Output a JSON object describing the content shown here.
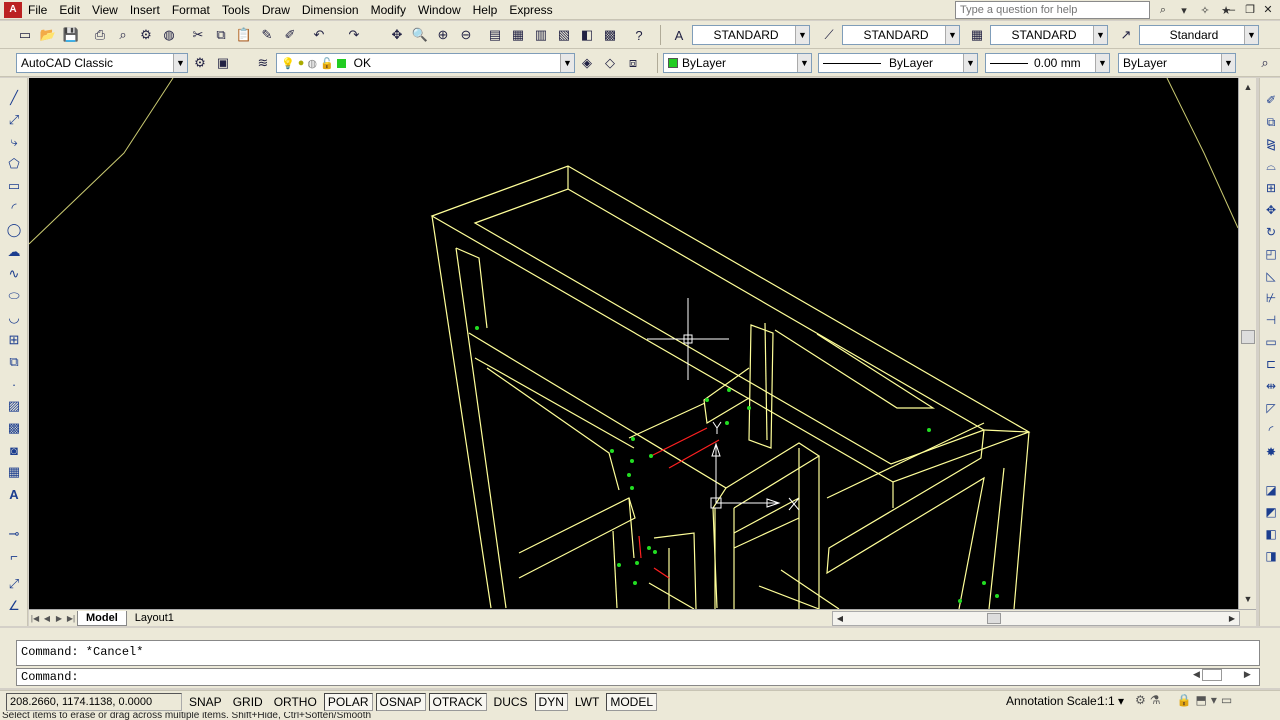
{
  "menubar": {
    "items": [
      "File",
      "Edit",
      "View",
      "Insert",
      "Format",
      "Tools",
      "Draw",
      "Dimension",
      "Modify",
      "Window",
      "Help",
      "Express"
    ],
    "help_placeholder": "Type a question for help"
  },
  "toolbar1": {
    "text_style": "STANDARD",
    "dim_style": "STANDARD",
    "table_style": "STANDARD",
    "multileader_style": "Standard"
  },
  "toolbar2": {
    "workspace": "AutoCAD Classic",
    "layer": "OK",
    "color": "ByLayer",
    "linetype": "ByLayer",
    "lineweight": "0.00 mm",
    "plotstyle": "ByLayer"
  },
  "layout_tabs": [
    {
      "label": "Model",
      "active": true
    },
    {
      "label": "Layout1",
      "active": false
    }
  ],
  "command": {
    "history": "Command: *Cancel*",
    "prompt": "Command:"
  },
  "status": {
    "coordinates": "208.2660, 1174.1138, 0.0000",
    "toggles": [
      {
        "label": "SNAP",
        "on": false
      },
      {
        "label": "GRID",
        "on": false
      },
      {
        "label": "ORTHO",
        "on": false
      },
      {
        "label": "POLAR",
        "on": true
      },
      {
        "label": "OSNAP",
        "on": true
      },
      {
        "label": "OTRACK",
        "on": true
      },
      {
        "label": "DUCS",
        "on": false
      },
      {
        "label": "DYN",
        "on": true
      },
      {
        "label": "LWT",
        "on": false
      },
      {
        "label": "MODEL",
        "on": true
      }
    ],
    "annotation_scale_label": "Annotation Scale:",
    "annotation_scale": "1:1",
    "tip": "Select items to erase or drag across multiple items. Shift+Hide, Ctrl+Soften/Smooth"
  },
  "colors": {
    "canvas_bg": "#000000",
    "wire": "#ffff99",
    "highlight": "#ff2020",
    "grip": "#22dd22"
  }
}
